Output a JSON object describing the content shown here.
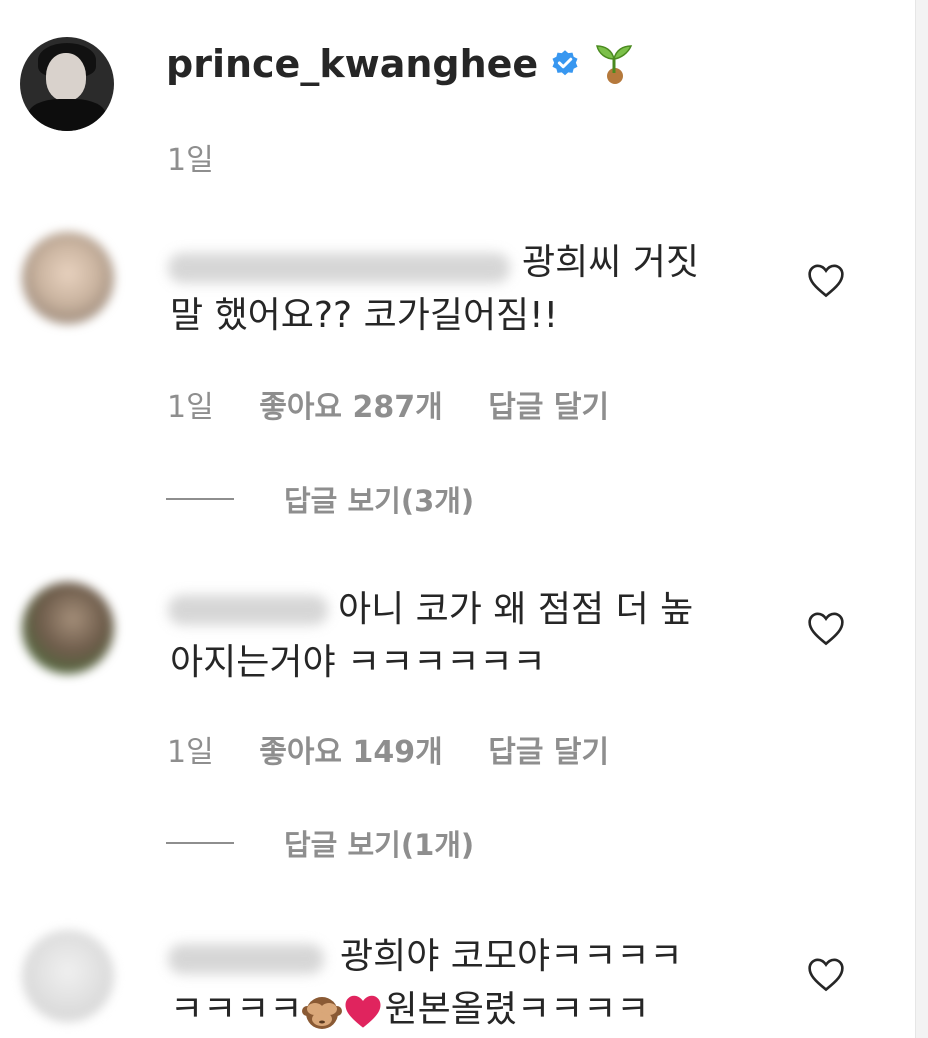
{
  "post": {
    "username": "prince_kwanghee",
    "verified_icon": "verified-badge-icon",
    "emoji_icon": "seedling-icon",
    "time": "1일"
  },
  "comments": [
    {
      "text_line1": "광희씨 거짓",
      "text_line2": "말 했어요?? 코가길어짐!!",
      "time": "1일",
      "likes": "좋아요 287개",
      "reply": "답글 달기",
      "view_replies": "답글 보기(3개)"
    },
    {
      "text_line1": "아니 코가 왜 점점 더 높",
      "text_line2": "아지는거야 ㅋㅋㅋㅋㅋㅋ",
      "time": "1일",
      "likes": "좋아요 149개",
      "reply": "답글 달기",
      "view_replies": "답글 보기(1개)"
    },
    {
      "text_line1": "광희야 코모야ㅋㅋㅋㅋ",
      "text_line2_a": "ㅋㅋㅋㅋ",
      "text_line2_b": "원본올렸ㅋㅋㅋㅋ",
      "emoji_1": "see-no-evil-monkey-icon",
      "emoji_2": "red-heart-icon"
    }
  ],
  "colors": {
    "text": "#262626",
    "secondary": "#8e8e8e",
    "verified": "#3897f0",
    "heart_outline": "#262626",
    "red_heart": "#e0245e"
  }
}
